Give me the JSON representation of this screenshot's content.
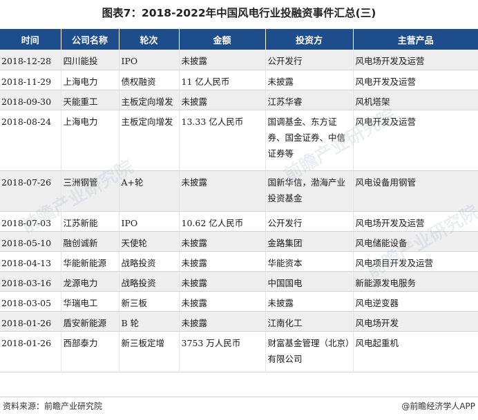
{
  "title": "图表7：2018-2022年中国风电行业投融资事件汇总(三)",
  "columns": [
    "时间",
    "公司名称",
    "轮次",
    "金额",
    "投资方",
    "主营产品"
  ],
  "rows": [
    [
      "2018-12-28",
      "四川能投",
      "IPO",
      "未披露",
      "公开发行",
      "风电场开发及运营"
    ],
    [
      "2018-11-29",
      "上海电力",
      "债权融资",
      "11 亿人民币",
      "未披露",
      "风电开发及运营"
    ],
    [
      "2018-09-30",
      "天能重工",
      "主板定向增发",
      "未披露",
      "江苏华睿",
      "风机塔架"
    ],
    [
      "2018-08-24",
      "上海电力",
      "主板定向增发",
      "13.33 亿人民币",
      "国调基金、东方证券、国金证券、中信证券等",
      "风电开发及运营"
    ],
    [
      "2018-07-26",
      "三洲钢管",
      "A+轮",
      "未披露",
      "国新华信，渤海产业投资基金",
      "风电设备用钢管"
    ],
    [
      "2018-07-03",
      "江苏新能",
      "IPO",
      "10.62 亿人民币",
      "公开发行",
      "风电场开发及运营"
    ],
    [
      "2018-05-10",
      "融创诚新",
      "天使轮",
      "未披露",
      "金路集团",
      "风电储能设备"
    ],
    [
      "2018-04-13",
      "华能新能源",
      "战略投资",
      "未披露",
      "华能资本",
      "风电项目开发及运营"
    ],
    [
      "2018-03-16",
      "龙源电力",
      "战略投资",
      "未披露",
      "中国国电",
      "新能源发电服务"
    ],
    [
      "2018-03-05",
      "华瑞电工",
      "新三板",
      "未披露",
      "未披露",
      "风电逆变器"
    ],
    [
      "2018-01-26",
      "盾安新能源",
      "B 轮",
      "未披露",
      "江南化工",
      "风电场开发"
    ],
    [
      "2018-01-26",
      "西部泰力",
      "新三板定增",
      "3753 万人民币",
      "财富基金管理（北京）有限公司",
      "风电起重机"
    ]
  ],
  "watermark_text": "前瞻产业研究院",
  "footer": {
    "source": "资料来源：前瞻产业研究院",
    "brand": "@前瞻经济学人APP"
  },
  "colors": {
    "header_bg": "#1e4d8c",
    "row_alt_bg": "#efefef"
  }
}
